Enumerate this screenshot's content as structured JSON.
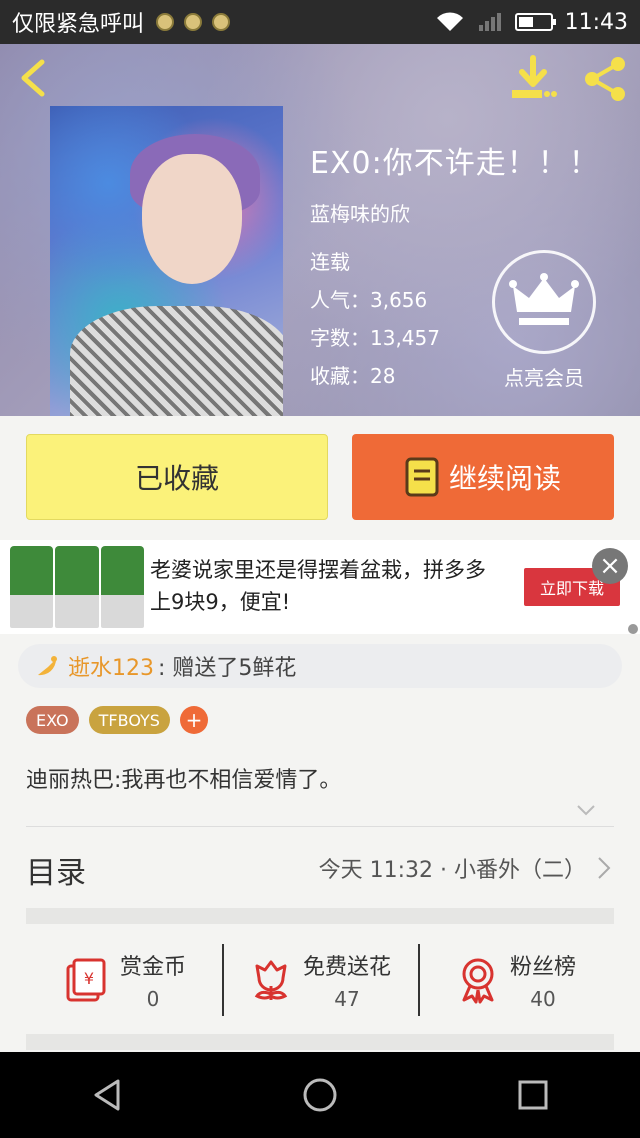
{
  "status_bar": {
    "carrier": "仅限紧急呼叫",
    "time": "11:43"
  },
  "book": {
    "title": "EX0:你不许走！！！",
    "author": "蓝梅味的欣",
    "status": "连载",
    "popularity_label": "人气：",
    "popularity": "3,656",
    "words_label": "字数：",
    "words": "13,457",
    "favorites_label": "收藏：",
    "favorites": "28",
    "vip_label": "点亮会员"
  },
  "actions": {
    "collected": "已收藏",
    "continue_read": "继续阅读"
  },
  "ad": {
    "text": "老婆说家里还是得摆着盆栽，拼多多上9块9，便宜!",
    "cta": "立即下载",
    "close": "×"
  },
  "gift": {
    "user": "逝水123",
    "message": ": 赠送了5鲜花"
  },
  "tags": [
    "EXO",
    "TFBOYS"
  ],
  "tag_add": "+",
  "intro": "迪丽热巴:我再也不相信爱情了。",
  "toc": {
    "label": "目录",
    "latest": "今天 11:32 · 小番外（二）"
  },
  "stats": [
    {
      "label": "赏金币",
      "value": "0",
      "icon": "red-envelope-icon"
    },
    {
      "label": "免费送花",
      "value": "47",
      "icon": "flower-icon"
    },
    {
      "label": "粉丝榜",
      "value": "40",
      "icon": "medal-icon"
    }
  ],
  "colors": {
    "accent_orange": "#ef6a37",
    "collected_yellow": "#fbf27a",
    "gift_user": "#e8972a",
    "icon_red": "#d8332f"
  }
}
